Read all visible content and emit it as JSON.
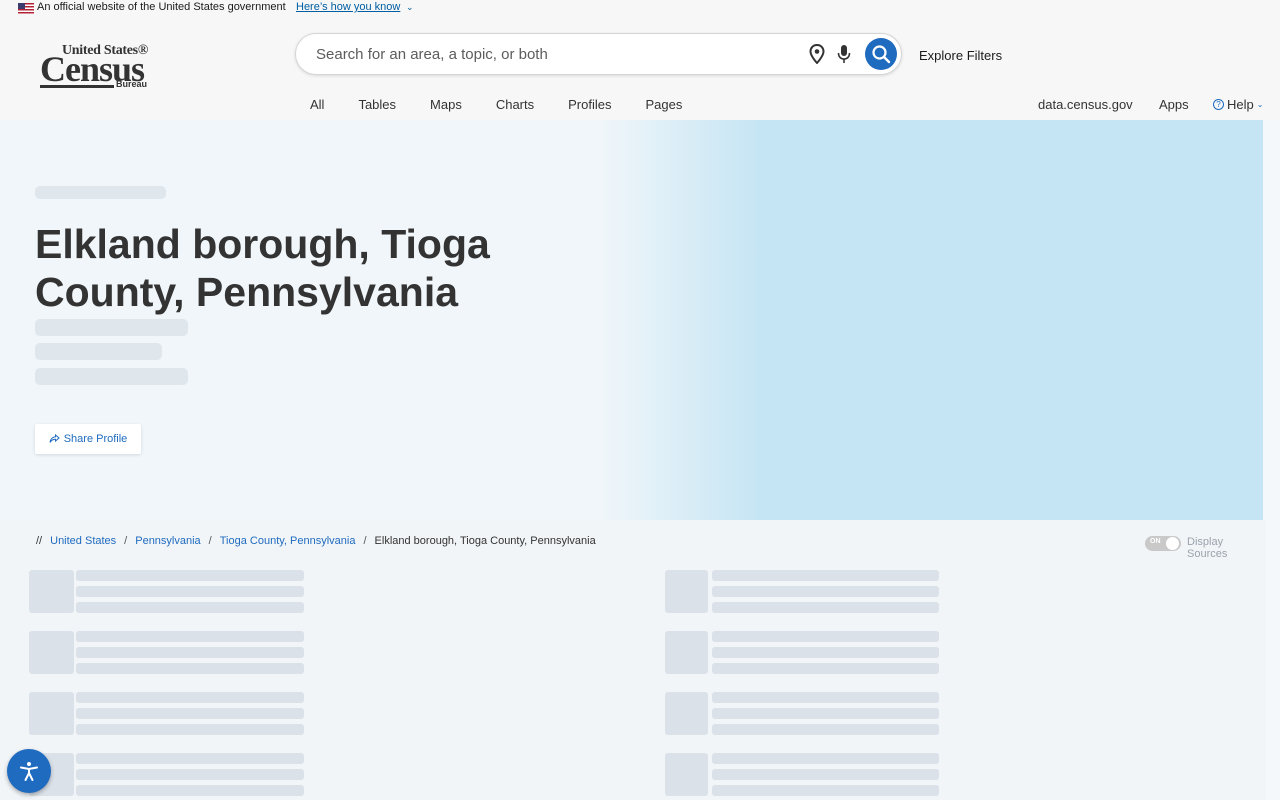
{
  "gov_banner": {
    "text": "An official website of the United States government",
    "link": "Here’s how you know"
  },
  "logo": {
    "line1": "United States®",
    "line2": "Census",
    "line3": "Bureau"
  },
  "search": {
    "placeholder": "Search for an area, a topic, or both"
  },
  "header": {
    "explore_filters": "Explore Filters",
    "tabs": [
      "All",
      "Tables",
      "Maps",
      "Charts",
      "Profiles",
      "Pages"
    ],
    "right_nav": {
      "data": "data.census.gov",
      "apps": "Apps",
      "help": "Help"
    }
  },
  "hero": {
    "title": "Elkland borough, Tioga County, Pennsylvania",
    "share_label": "Share Profile"
  },
  "breadcrumb": {
    "prefix": "//",
    "items": [
      "United States",
      "Pennsylvania",
      "Tioga County, Pennsylvania"
    ],
    "current": "Elkland borough, Tioga County, Pennsylvania"
  },
  "display_sources": {
    "toggle_state": "ON",
    "label": "Display Sources"
  },
  "colors": {
    "accent": "#1f6bbf",
    "hero_right": "#c6e5f4",
    "hero_left": "#f0f6fa"
  },
  "icons": [
    "flag-icon",
    "location-pin-icon",
    "microphone-icon",
    "search-icon",
    "help-circle-icon",
    "share-icon",
    "accessibility-icon"
  ]
}
